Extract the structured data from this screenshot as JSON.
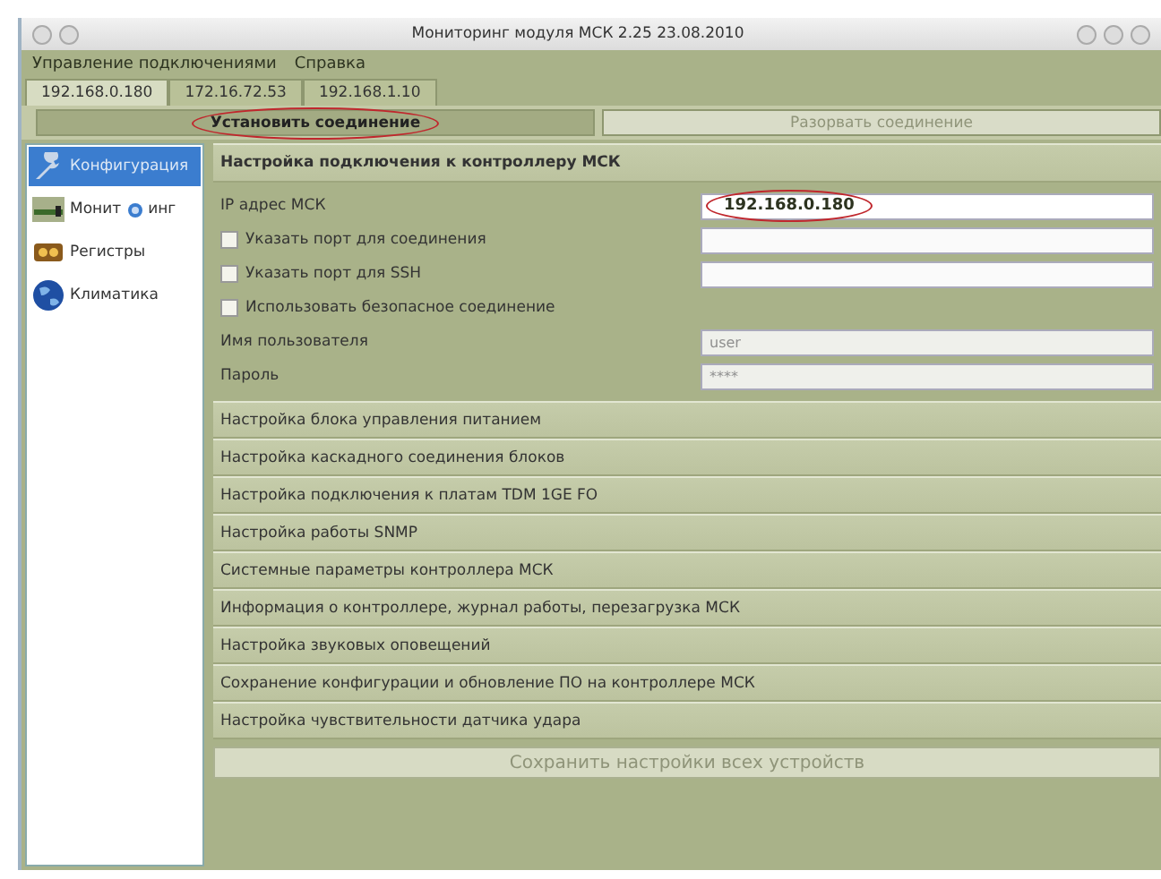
{
  "window": {
    "title": "Мониторинг модуля МСК 2.25 23.08.2010"
  },
  "menu": [
    "Управление подключениями",
    "Справка"
  ],
  "tabs": [
    {
      "label": "192.168.0.180",
      "selected": true
    },
    {
      "label": "172.16.72.53",
      "selected": false
    },
    {
      "label": "192.168.1.10",
      "selected": false
    }
  ],
  "connection_buttons": [
    {
      "label": "Установить соединение",
      "disabled": false,
      "circled": true
    },
    {
      "label": "Разорвать соединение",
      "disabled": true,
      "circled": false
    }
  ],
  "sidebar": {
    "items": [
      {
        "label_parts": [
          "Конфигурация"
        ],
        "selected": true
      },
      {
        "label_parts": [
          "Монит",
          "инг"
        ],
        "selected": false
      },
      {
        "label_parts": [
          "Регистры"
        ],
        "selected": false
      },
      {
        "label_parts": [
          "Климатика"
        ],
        "selected": false
      }
    ]
  },
  "open_section": {
    "title": "Настройка подключения к контроллеру МСК",
    "rows": [
      {
        "kind": "field",
        "label": "IP адрес МСК",
        "value": "192.168.0.180",
        "circled": true,
        "disabled": false
      },
      {
        "kind": "checkfield",
        "label": "Указать порт для соединения",
        "checked": false
      },
      {
        "kind": "checkfield",
        "label": "Указать порт для SSH",
        "checked": false
      },
      {
        "kind": "check",
        "label": "Использовать безопасное соединение",
        "checked": false
      },
      {
        "kind": "field",
        "label": "Имя пользователя",
        "placeholder": "user",
        "disabled": true,
        "circled": false
      },
      {
        "kind": "field",
        "label": "Пароль",
        "placeholder": "****",
        "disabled": true,
        "circled": false
      }
    ]
  },
  "sections": [
    "Настройка блока управления питанием",
    "Настройка каскадного соединения блоков",
    "Настройка подключения к платам TDM 1GE FO",
    "Настройка работы SNMP",
    "Системные параметры контроллера МСК",
    "Информация о контроллере, журнал работы, перезагрузка МСК",
    "Настройка звуковых оповещений",
    "Сохранение конфигурации и обновление ПО на контроллере МСК",
    "Настройка чувствительности датчика удара"
  ],
  "save_button": {
    "label": "Сохранить настройки всех устройств",
    "disabled": true
  }
}
